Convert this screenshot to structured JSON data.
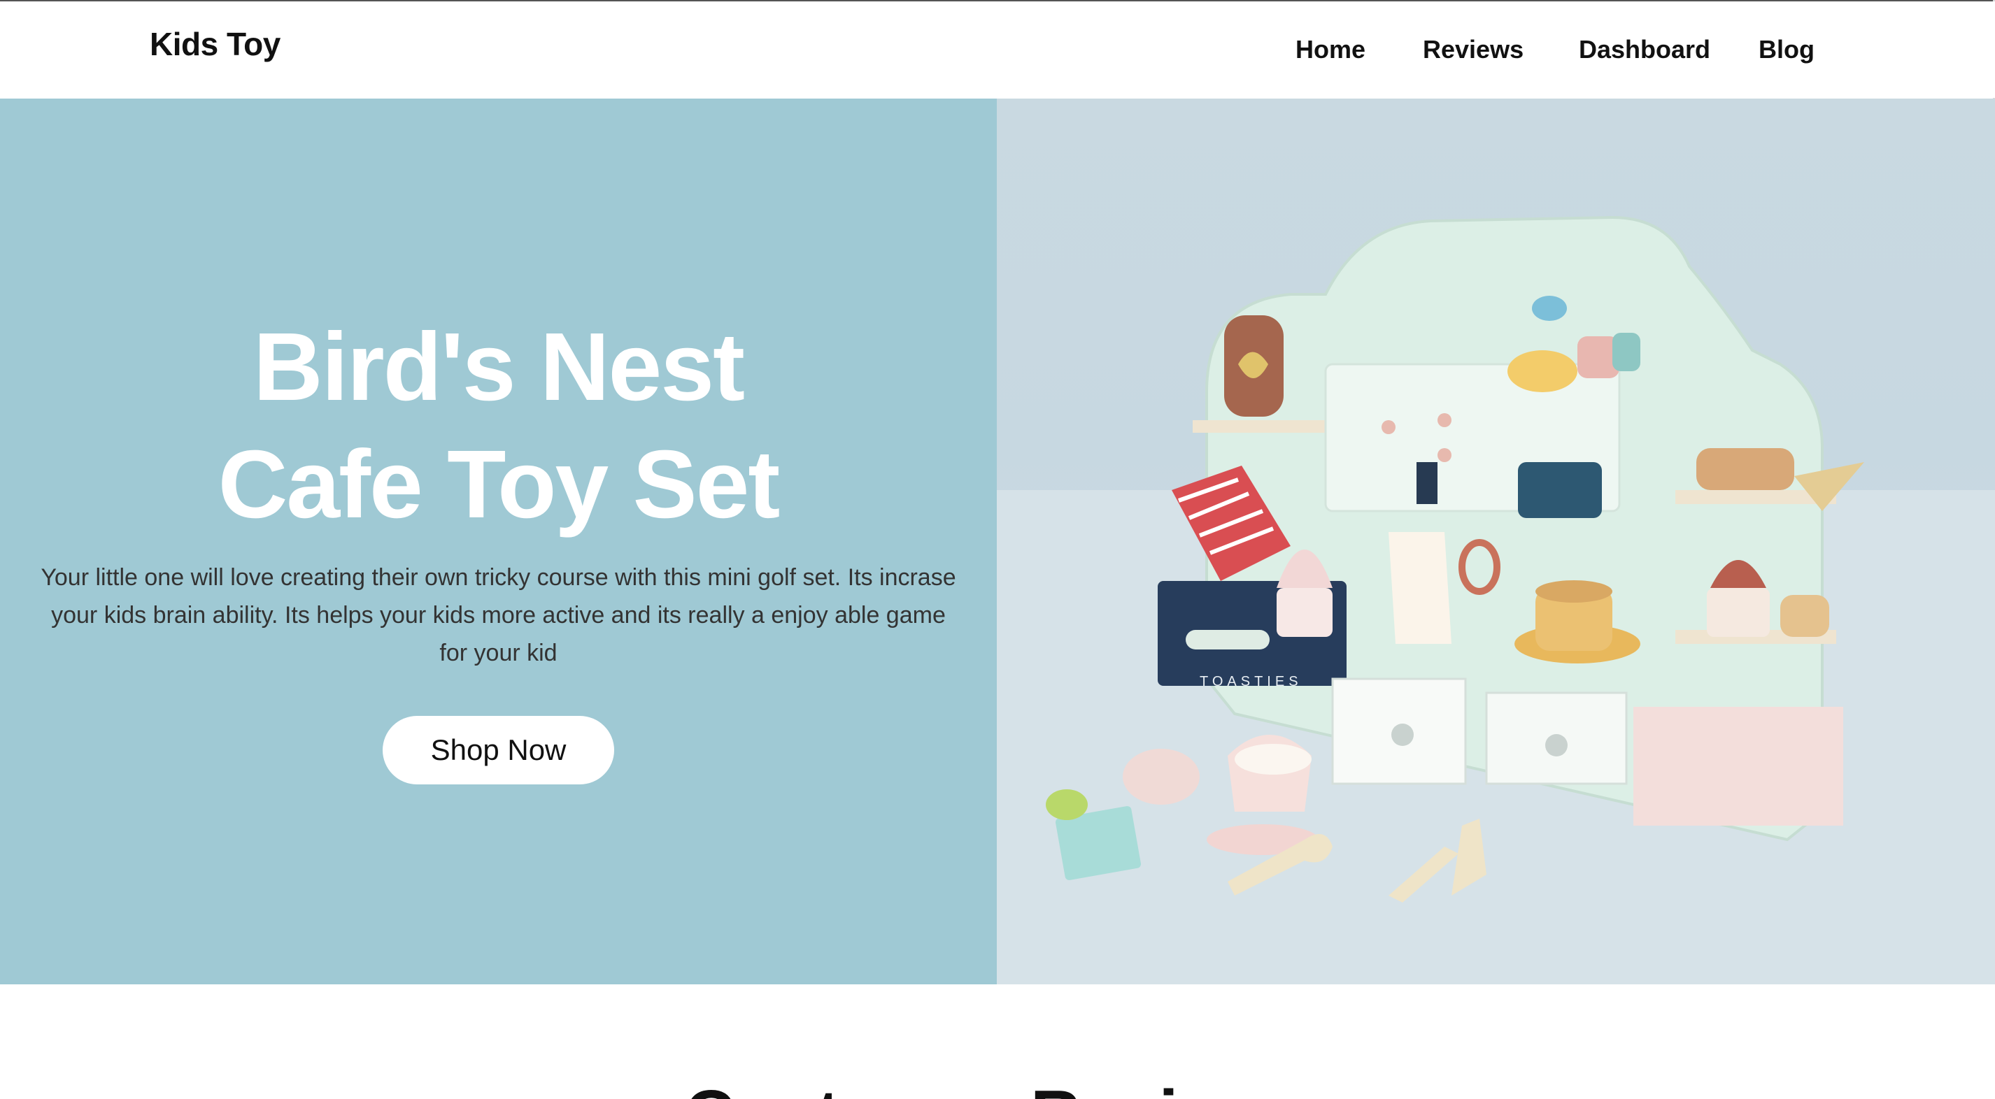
{
  "header": {
    "brand": "Kids Toy",
    "nav": [
      "Home",
      "Reviews",
      "Dashboard",
      "Blog"
    ]
  },
  "hero": {
    "title_line1": "Bird's Nest",
    "title_line2": "Cafe Toy Set",
    "description": "Your little one will love creating their own tricky course with this mini golf set. Its incrase your kids brain ability. Its helps your kids more active and its really a enjoy able game for your kid",
    "cta_label": "Shop Now",
    "image_alt": "Bird's Nest Cafe Toy Set product photo",
    "panel_color": "#9fc9d4"
  },
  "section": {
    "heading": "Customer Reviews"
  }
}
